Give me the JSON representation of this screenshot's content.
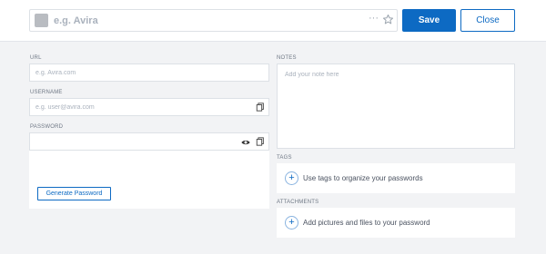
{
  "header": {
    "title_placeholder": "e.g. Avira",
    "more_glyph": "···",
    "save_label": "Save",
    "close_label": "Close"
  },
  "form": {
    "url": {
      "label": "URL",
      "placeholder": "e.g. Avira.com"
    },
    "username": {
      "label": "USERNAME",
      "placeholder": "e.g. user@avira.com"
    },
    "password": {
      "label": "PASSWORD",
      "placeholder": ""
    },
    "generate_label": "Generate Password",
    "notes": {
      "label": "NOTES",
      "placeholder": "Add your note here"
    },
    "tags": {
      "label": "TAGS",
      "text": "Use tags to organize your passwords"
    },
    "attachments": {
      "label": "ATTACHMENTS",
      "text": "Add pictures and files to your password"
    }
  },
  "icons": {
    "star": "star-icon",
    "copy": "copy-icon",
    "eye": "eye-icon",
    "plus": "plus-icon",
    "plus_glyph": "+"
  },
  "colors": {
    "accent": "#0d6ac3",
    "background": "#f2f3f5",
    "swatch": "#b9bcc1"
  }
}
